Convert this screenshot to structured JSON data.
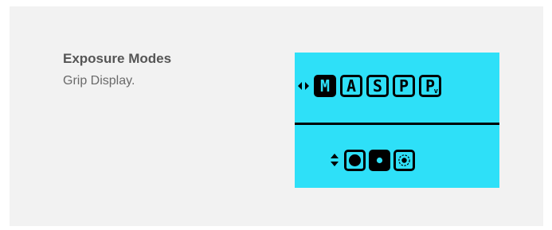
{
  "info": {
    "title": "Exposure Modes",
    "subtitle": "Grip Display."
  },
  "lcd": {
    "background_color": "#2ee0f8",
    "modes": [
      {
        "label": "M",
        "sub": "",
        "active": true
      },
      {
        "label": "A",
        "sub": "",
        "active": false
      },
      {
        "label": "S",
        "sub": "",
        "active": false
      },
      {
        "label": "P",
        "sub": "",
        "active": false
      },
      {
        "label": "P",
        "sub": "v",
        "active": false
      }
    ],
    "mode_nav_icon": "left-right-arrow-icon",
    "metering_nav_icon": "up-down-arrow-icon",
    "metering": [
      {
        "icon": "matrix-metering-icon",
        "active": false
      },
      {
        "icon": "center-weighted-metering-icon",
        "active": true
      },
      {
        "icon": "spot-metering-icon",
        "active": false
      }
    ]
  }
}
